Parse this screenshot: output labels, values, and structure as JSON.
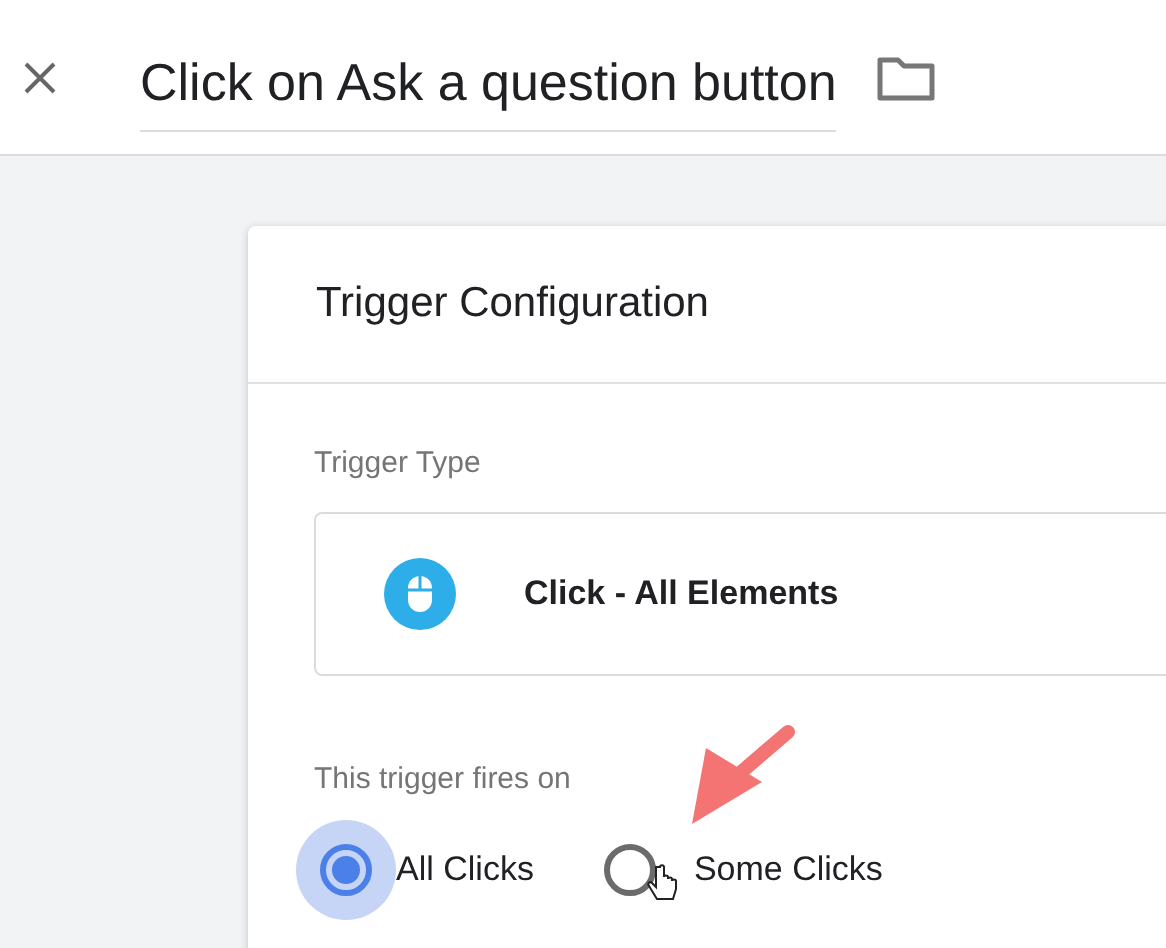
{
  "header": {
    "title": "Click on Ask a question button"
  },
  "card": {
    "title": "Trigger Configuration",
    "trigger_type_label": "Trigger Type",
    "trigger_type": "Click - All Elements",
    "fires_on_label": "This trigger fires on",
    "options": [
      {
        "label": "All Clicks",
        "selected": true
      },
      {
        "label": "Some Clicks",
        "selected": false
      }
    ]
  }
}
